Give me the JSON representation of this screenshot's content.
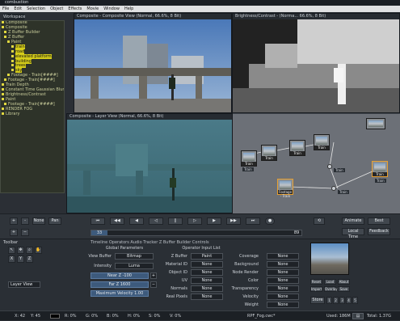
{
  "window_title": "combustion",
  "menu": [
    "File",
    "Edit",
    "Selection",
    "Object",
    "Effects",
    "Movie",
    "Window",
    "Help"
  ],
  "workspace_label": "Workspace",
  "tree": [
    {
      "text": "Composite",
      "ind": 0,
      "sel": false
    },
    {
      "text": "Composite",
      "ind": 0,
      "sel": false
    },
    {
      "text": "Z Buffer Builder",
      "ind": 1,
      "sel": false
    },
    {
      "text": "Z Buffer",
      "ind": 1,
      "sel": false
    },
    {
      "text": "Paint",
      "ind": 2,
      "sel": false
    },
    {
      "text": "train",
      "ind": 3,
      "sel": true
    },
    {
      "text": "road",
      "ind": 3,
      "sel": true
    },
    {
      "text": "elevated platform",
      "ind": 3,
      "sel": true
    },
    {
      "text": "building",
      "ind": 3,
      "sel": true
    },
    {
      "text": "trees",
      "ind": 3,
      "sel": true
    },
    {
      "text": "sky",
      "ind": 3,
      "sel": true
    },
    {
      "text": "Footage - Train[####]",
      "ind": 2,
      "sel": false
    },
    {
      "text": "Footage - Train[####]",
      "ind": 1,
      "sel": false
    },
    {
      "text": "Train Depth",
      "ind": 0,
      "sel": false
    },
    {
      "text": "Constant Time Gaussian Blur",
      "ind": 0,
      "sel": false
    },
    {
      "text": "Brightness/Contrast",
      "ind": 0,
      "sel": false
    },
    {
      "text": "Paint",
      "ind": 0,
      "sel": false
    },
    {
      "text": "Footage - Train[####]",
      "ind": 1,
      "sel": false
    },
    {
      "text": "RENDER FOG",
      "ind": 0,
      "sel": false
    },
    {
      "text": "Library",
      "ind": 0,
      "sel": false
    }
  ],
  "viewers": {
    "composite_title": "Composite - Composite View (Normal, 66.6%, 8 Bit)",
    "brightness_title": "Brightness/Contrast - (Norma... 66.6%, 8 Bit)",
    "layer_title": "Composite - Layer View (Normal, 66.6%, 8 Bit)"
  },
  "schematic": {
    "nodes": [
      "Train",
      "Train",
      "Train",
      "Train",
      "Train",
      "Footage - Train",
      "Train"
    ],
    "chips": [
      "Train",
      "Train",
      "Train",
      "Train"
    ]
  },
  "transport": {
    "left_buttons": [
      "+",
      "-",
      "None",
      "Pan"
    ],
    "frame_start": "33",
    "frame_end": "89",
    "right_buttons": [
      "Animate",
      "Best",
      "Local Time",
      "Feedback"
    ]
  },
  "bottom": {
    "toolbar_label": "Toolbar",
    "tabs_label": "Timeline  Operators  Audio  Tracker  Z Buffer Builder Controls",
    "tool_labels": [
      "X",
      "Y",
      "Z"
    ],
    "layer_view": "Layer View",
    "global_params_title": "Global Parameters",
    "view_buffer_label": "View Buffer",
    "view_buffer_value": "Bitmap",
    "intensity_label": "Intensity",
    "intensity_value": "Luma",
    "near_z": "Near Z -100",
    "far_z": "Far Z 1600",
    "max_velocity": "Maximum Velocity 1.00",
    "operator_input_title": "Operator Input List",
    "op_rows": [
      {
        "label": "Z Buffer",
        "value": "Paint"
      },
      {
        "label": "Material ID",
        "value": "None"
      },
      {
        "label": "Object ID",
        "value": "None"
      },
      {
        "label": "UV",
        "value": "None"
      },
      {
        "label": "Normals",
        "value": "None"
      },
      {
        "label": "Real Pixels",
        "value": "None"
      }
    ],
    "op_rows_right": [
      {
        "label": "Coverage",
        "value": "None"
      },
      {
        "label": "Background",
        "value": "None"
      },
      {
        "label": "Node Render",
        "value": "None"
      },
      {
        "label": "Color",
        "value": "None"
      },
      {
        "label": "Transparency",
        "value": "None"
      },
      {
        "label": "Velocity",
        "value": "None"
      },
      {
        "label": "Weight",
        "value": "None"
      }
    ],
    "preview_buttons": [
      "Reset",
      "Load",
      "About",
      "Import",
      "Overlay",
      "Save"
    ],
    "store_label": "Store"
  },
  "status": {
    "x": "X: 42",
    "y": "Y: 45",
    "r": "R: 0%",
    "g": "G: 0%",
    "b": "B: 0%",
    "h": "H: 0%",
    "s": "S: 0%",
    "v": "V: 0%",
    "file": "RPF_Fog.cwc*",
    "used": "Used: 186M",
    "total": "Total: 1.37G"
  }
}
